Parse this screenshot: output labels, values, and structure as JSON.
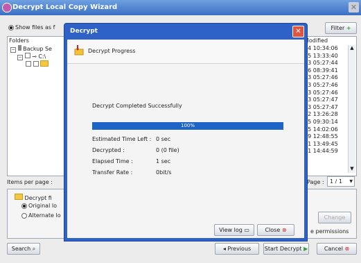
{
  "wizard": {
    "title": "Decrypt Local Copy Wizard",
    "show_files_label": "Show files as f",
    "filter_label": "Filter",
    "folders_header": "Folders",
    "modified_header": "Modified",
    "tree": [
      "Backup Se",
      "C:\\",
      ""
    ],
    "modified_values": [
      "24 10:34:06",
      "05 13:33:40",
      "03 05:27:44",
      "06 08:39:41",
      "03 05:27:46",
      "03 05:27:46",
      "03 05:27:46",
      "03 05:27:47",
      "03 05:27:47",
      "12 13:26:28",
      "15 09:30:14",
      "15 14:02:06",
      "19 12:48:55",
      "01 13:49:45",
      "01 14:44:59"
    ],
    "items_per_page_label": "Items per page :",
    "page_label": "Page :",
    "page_value": "1 / 1",
    "decrypt_to_label": "Decrypt fi",
    "original_label": "Original lo",
    "alternate_label": "Alternate lo",
    "change_label": "Change",
    "permissions_label": "e permissions",
    "search_label": "Search",
    "previous_label": "Previous",
    "start_decrypt_label": "Start Decrypt",
    "cancel_label": "Cancel"
  },
  "dialog": {
    "title": "Decrypt",
    "close_glyph": "✕",
    "header": "Decrypt Progress",
    "status": "Decrypt Completed Successfully",
    "progress_text": "100%",
    "progress": 1.0,
    "rows": [
      {
        "label": "Estimated Time Left :",
        "value": "0 sec"
      },
      {
        "label": "Decrypted :",
        "value": "0 (0 file)"
      },
      {
        "label": "Elapsed Time :",
        "value": "1 sec"
      },
      {
        "label": "Transfer Rate :",
        "value": "0bit/s"
      }
    ],
    "view_log_label": "View log",
    "close_label": "Close"
  },
  "colors": {
    "title_bar": "#3b6fc4",
    "dialog_frame": "#2f62c6",
    "progress": "#1e63c6",
    "close_red": "#e05540"
  },
  "icons": [
    "app-icon",
    "close-icon",
    "filter-icon",
    "folder-icon",
    "drive-icon",
    "search-icon",
    "arrow-left-icon",
    "arrow-right-icon",
    "cancel-icon",
    "view-log-icon",
    "decrypt-progress-icon"
  ]
}
